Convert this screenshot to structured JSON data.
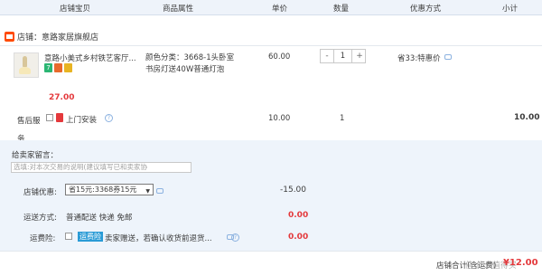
{
  "header": {
    "col_item": "店铺宝贝",
    "col_attr": "商品属性",
    "col_price": "单价",
    "col_qty": "数量",
    "col_promo": "优惠方式",
    "col_subtotal": "小计"
  },
  "store": {
    "label": "店铺：",
    "name": "意路家居旗舰店"
  },
  "item": {
    "title": "意路小美式乡村铁艺客厅...",
    "badge_days": "7",
    "price_red": "27.00",
    "attr_lines": [
      "颜色分类：3668-1头卧室",
      "书房灯送40W普通灯泡"
    ],
    "unit_price": "60.00",
    "qty": "1",
    "qty_minus": "-",
    "qty_plus": "+",
    "promo": "省33:特惠价"
  },
  "service": {
    "label": "售后服务",
    "option": "上门安装",
    "help": "?",
    "price": "10.00",
    "qty": "1",
    "subtotal": "10.00"
  },
  "summary": {
    "message_label": "给卖家留言：",
    "message_placeholder": "选填:对本次交易的说明(建议填写已和卖家协",
    "discount_label": "店铺优惠:",
    "discount_option": "省15元:3368券15元",
    "discount_amount": "-15.00",
    "shipping_label": "运送方式:",
    "shipping_value": "普通配送 快递 免邮",
    "shipping_amount": "0.00",
    "insurance_label": "运费险:",
    "insurance_tag": "运费险",
    "insurance_text": "卖家赠送，若确认收货前退货...",
    "insurance_amount": "0.00",
    "total_label": "店铺合计(含运费)",
    "total_value": "¥12.00",
    "watermark": "值 什么值得买"
  },
  "colors": {
    "accent_red": "#e4393c",
    "header_bg": "#eef3fa",
    "summary_bg": "#eef4fb",
    "store_orange": "#ff4a00"
  }
}
